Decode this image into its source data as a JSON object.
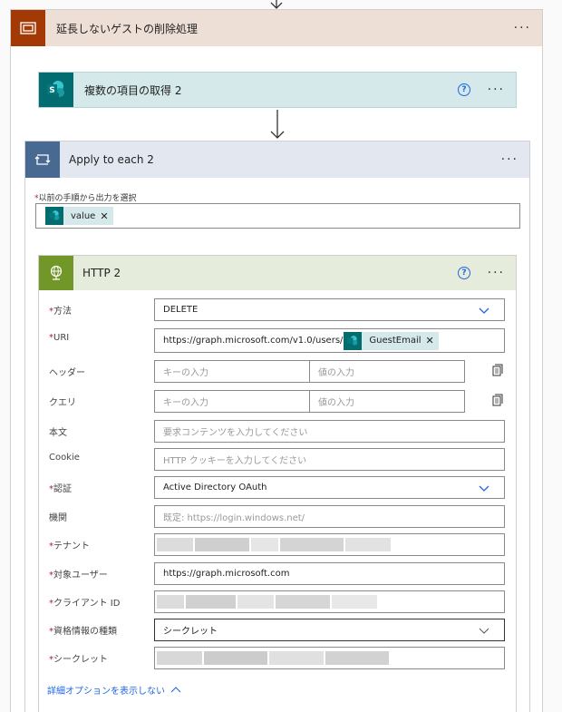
{
  "scope": {
    "title": "延長しないゲストの削除処理",
    "more": "···"
  },
  "get_items": {
    "title": "複数の項目の取得 2",
    "help": "?",
    "more": "···"
  },
  "apply_to_each": {
    "title": "Apply to each 2",
    "more": "···",
    "required_mark": "*",
    "field_label": "以前の手順から出力を選択",
    "token": {
      "label": "value",
      "remove": "✕"
    }
  },
  "http": {
    "title": "HTTP 2",
    "help": "?",
    "more": "···",
    "required_mark": "*",
    "method": {
      "label": "方法",
      "value": "DELETE"
    },
    "uri": {
      "label": "URI",
      "value": "https://graph.microsoft.com/v1.0/users/",
      "token": "GuestEmail",
      "remove": "✕"
    },
    "headers": {
      "label": "ヘッダー",
      "key_placeholder": "キーの入力",
      "value_placeholder": "値の入力"
    },
    "queries": {
      "label": "クエリ",
      "key_placeholder": "キーの入力",
      "value_placeholder": "値の入力"
    },
    "body": {
      "label": "本文",
      "placeholder": "要求コンテンツを入力してください"
    },
    "cookie": {
      "label": "Cookie",
      "placeholder": "HTTP クッキーを入力してください"
    },
    "auth": {
      "label": "認証",
      "value": "Active Directory OAuth"
    },
    "authority": {
      "label": "機関",
      "placeholder": "既定: https://login.windows.net/"
    },
    "tenant": {
      "label": "テナント"
    },
    "audience": {
      "label": "対象ユーザー",
      "value": "https://graph.microsoft.com"
    },
    "client_id": {
      "label": "クライアント ID"
    },
    "credential_type": {
      "label": "資格情報の種類",
      "value": "シークレット"
    },
    "secret": {
      "label": "シークレット"
    },
    "advanced_link": "詳細オプションを表示しない"
  },
  "colors": {
    "scope_header": "#eedfd6",
    "scope_icon": "#a33a06",
    "sharepoint": "#036c70",
    "loop": "#486991",
    "http": "#709727",
    "link": "#2266e3",
    "required": "#a4262c"
  }
}
